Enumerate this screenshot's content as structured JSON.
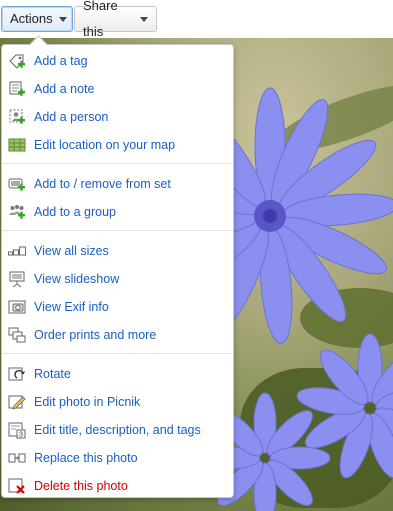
{
  "toolbar": {
    "actions_label": "Actions",
    "share_label": "Share this"
  },
  "menu": {
    "groups": [
      [
        {
          "label": "Add a tag",
          "icon": "add-tag-icon"
        },
        {
          "label": "Add a note",
          "icon": "add-note-icon"
        },
        {
          "label": "Add a person",
          "icon": "add-person-icon"
        },
        {
          "label": "Edit location on your map",
          "icon": "map-location-icon"
        }
      ],
      [
        {
          "label": "Add to / remove from set",
          "icon": "set-icon"
        },
        {
          "label": "Add to a group",
          "icon": "group-icon"
        }
      ],
      [
        {
          "label": "View all sizes",
          "icon": "all-sizes-icon"
        },
        {
          "label": "View slideshow",
          "icon": "slideshow-icon"
        },
        {
          "label": "View Exif info",
          "icon": "camera-icon"
        },
        {
          "label": "Order prints and more",
          "icon": "prints-icon"
        }
      ],
      [
        {
          "label": "Rotate",
          "icon": "rotate-icon"
        },
        {
          "label": "Edit photo in Picnik",
          "icon": "edit-photo-icon"
        },
        {
          "label": "Edit title, description, and tags",
          "icon": "edit-details-icon"
        },
        {
          "label": "Replace this photo",
          "icon": "replace-icon"
        },
        {
          "label": "Delete this photo",
          "icon": "delete-icon"
        }
      ]
    ]
  },
  "colors": {
    "link": "#1a5fc2",
    "danger": "#d20000",
    "flower": "#7d86f0"
  }
}
